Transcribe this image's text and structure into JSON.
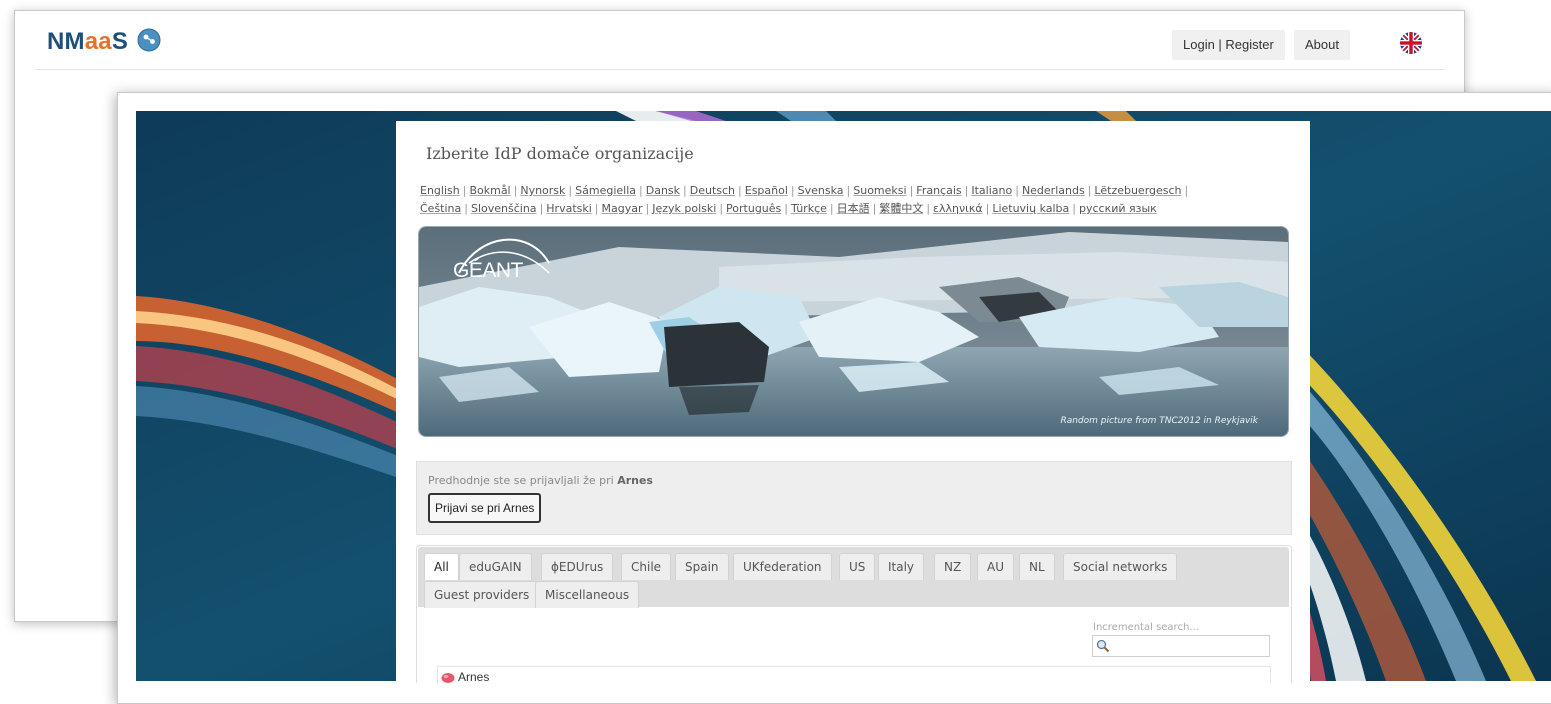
{
  "nmaas": {
    "logo_part1": "NM",
    "logo_part2": "aa",
    "logo_part3": "S",
    "login_label": "Login | Register",
    "about_label": "About",
    "language_flag": "uk-flag-icon"
  },
  "idp": {
    "title": "Izberite IdP domače organizacije",
    "languages": [
      "English",
      "Bokmål",
      "Nynorsk",
      "Sámegiella",
      "Dansk",
      "Deutsch",
      "Español",
      "Svenska",
      "Suomeksi",
      "Français",
      "Italiano",
      "Nederlands",
      "Lëtzebuergesch",
      "Čeština",
      "Slovenščina",
      "Hrvatski",
      "Magyar",
      "Język polski",
      "Português",
      "Türkçe",
      "日本語",
      "繁體中文",
      "ελληνικά",
      "Lietuvių kalba",
      "русский язык"
    ],
    "banner_logo": "GÉANT",
    "banner_caption": "Random picture from TNC2012 in Reykjavik",
    "previous_text": "Predhodnje ste se prijavljali že pri",
    "previous_org": "Arnes",
    "previous_button": "Prijavi se pri Arnes",
    "tabs_row1": [
      "All",
      "eduGAIN",
      "ϕEDUrus",
      "Chile",
      "Spain",
      "UKfederation",
      "US",
      "Italy",
      "NZ",
      "AU",
      "NL",
      "Social networks"
    ],
    "tabs_row2": [
      "Guest providers",
      "Miscellaneous"
    ],
    "search_label": "Incremental search...",
    "search_value": "",
    "list_items": [
      "Arnes"
    ]
  },
  "colors": {
    "nmaas_blue": "#1f4e79",
    "nmaas_orange": "#e8702a",
    "background_blue": "#0f4563"
  }
}
